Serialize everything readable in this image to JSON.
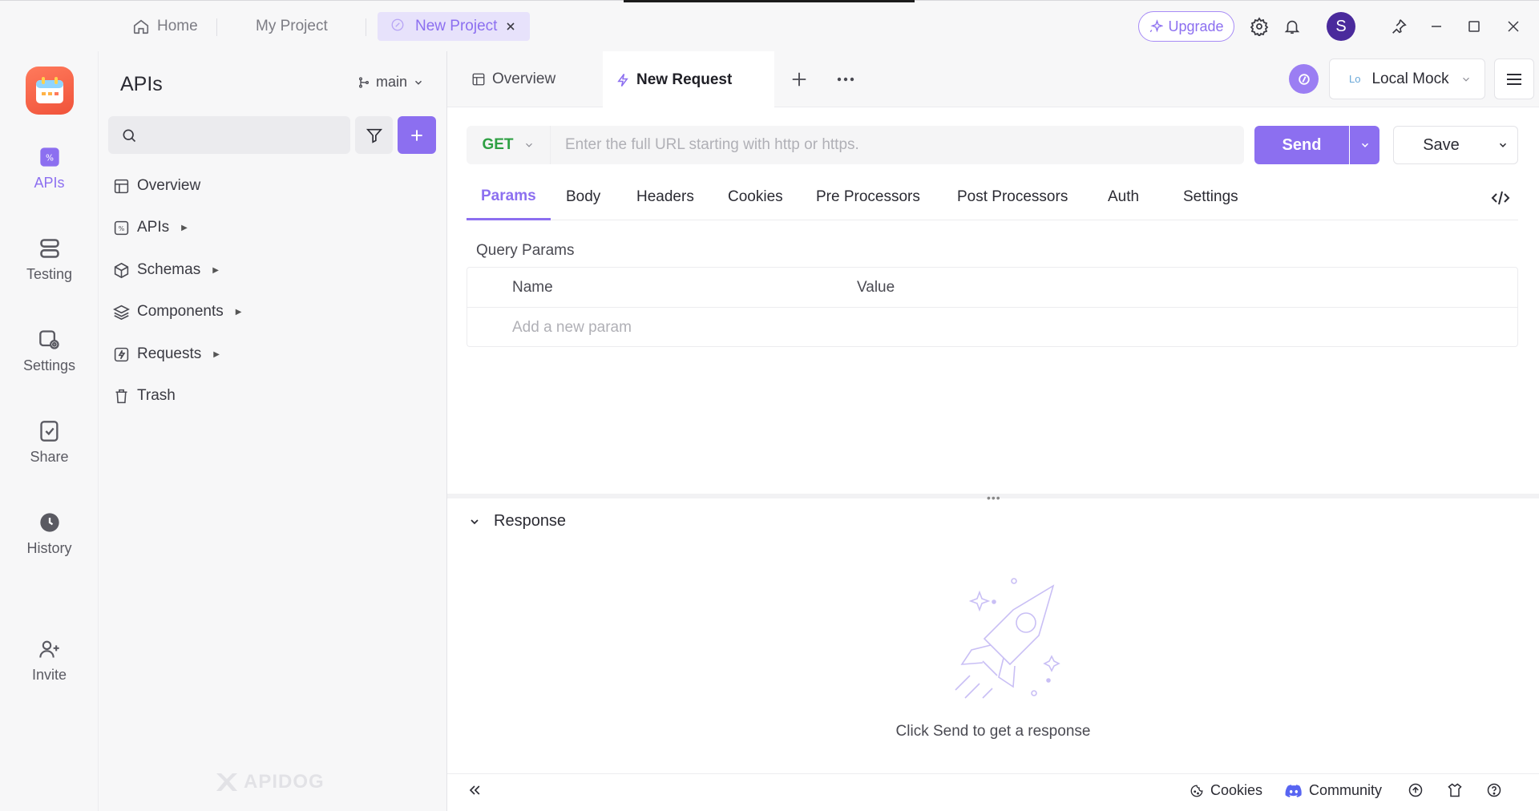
{
  "window": {
    "tabs": [
      {
        "label": "Home",
        "icon": "home-icon"
      },
      {
        "label": "My Project"
      },
      {
        "label": "New Project",
        "icon": "edit-icon",
        "active": true
      }
    ],
    "upgrade_label": "Upgrade",
    "avatar_initial": "S"
  },
  "rail": {
    "items": [
      {
        "label": "APIs",
        "icon": "apis-icon",
        "active": true
      },
      {
        "label": "Testing",
        "icon": "testing-icon"
      },
      {
        "label": "Settings",
        "icon": "settings-icon"
      },
      {
        "label": "Share",
        "icon": "share-icon"
      },
      {
        "label": "History",
        "icon": "history-icon"
      },
      {
        "label": "Invite",
        "icon": "invite-icon"
      }
    ]
  },
  "explorer": {
    "title": "APIs",
    "branch": "main",
    "search_placeholder": "",
    "tree": [
      {
        "label": "Overview",
        "icon": "overview-icon",
        "expandable": false
      },
      {
        "label": "APIs",
        "icon": "apis-icon",
        "expandable": true
      },
      {
        "label": "Schemas",
        "icon": "cube-icon",
        "expandable": true
      },
      {
        "label": "Components",
        "icon": "layers-icon",
        "expandable": true
      },
      {
        "label": "Requests",
        "icon": "bolt-icon",
        "expandable": true
      },
      {
        "label": "Trash",
        "icon": "trash-icon",
        "expandable": false
      }
    ],
    "brand": "APIDOG"
  },
  "main": {
    "tabs": [
      {
        "label": "Overview",
        "icon": "overview-icon"
      },
      {
        "label": "New Request",
        "icon": "bolt-icon",
        "active": true
      }
    ],
    "environment": {
      "prefix": "Lo",
      "label": "Local Mock"
    },
    "request": {
      "method": "GET",
      "url_value": "",
      "url_placeholder": "Enter the full URL starting with http or https.",
      "send_label": "Send",
      "save_label": "Save"
    },
    "subtabs": [
      "Params",
      "Body",
      "Headers",
      "Cookies",
      "Pre Processors",
      "Post Processors",
      "Auth",
      "Settings"
    ],
    "active_subtab": "Params",
    "query_params": {
      "label": "Query Params",
      "columns": [
        "Name",
        "Value"
      ],
      "add_placeholder": "Add a new param"
    },
    "response": {
      "title": "Response",
      "hint": "Click Send to get a response"
    },
    "bottombar": {
      "cookies_label": "Cookies",
      "community_label": "Community"
    }
  },
  "colors": {
    "accent": "#8c6ff0",
    "method_get": "#2ea043",
    "logo": "#f0533a"
  }
}
